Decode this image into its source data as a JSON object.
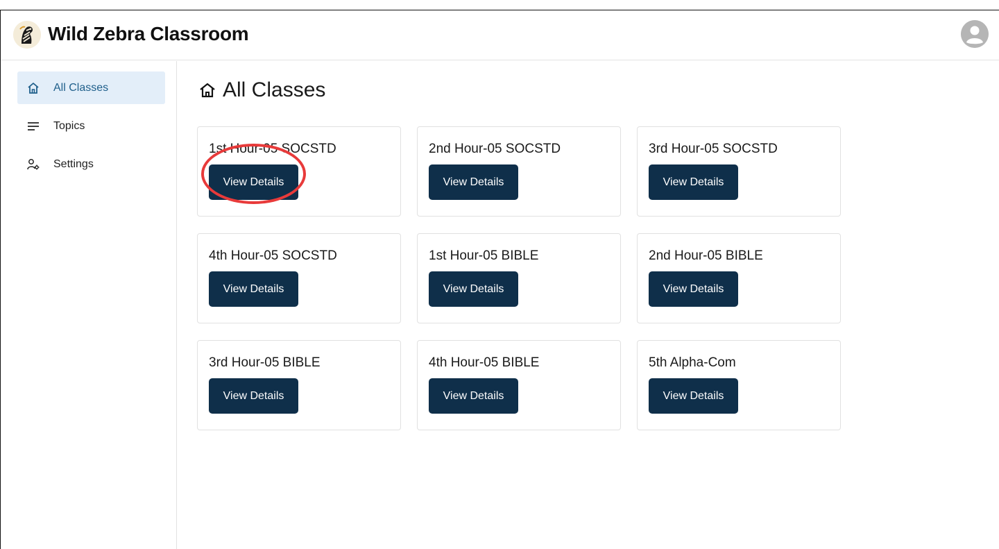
{
  "app": {
    "title": "Wild Zebra Classroom",
    "logo_icon": "zebra-logo-icon",
    "user_icon": "user-avatar-icon"
  },
  "sidebar": {
    "items": [
      {
        "label": "All Classes",
        "icon": "home-icon",
        "active": true
      },
      {
        "label": "Topics",
        "icon": "lines-icon",
        "active": false
      },
      {
        "label": "Settings",
        "icon": "user-gear-icon",
        "active": false
      }
    ]
  },
  "main": {
    "title": "All Classes",
    "title_icon": "home-icon",
    "classes": [
      {
        "name": "1st Hour-05 SOCSTD",
        "button": "View Details"
      },
      {
        "name": "2nd Hour-05 SOCSTD",
        "button": "View Details"
      },
      {
        "name": "3rd Hour-05 SOCSTD",
        "button": "View Details"
      },
      {
        "name": "4th Hour-05 SOCSTD",
        "button": "View Details"
      },
      {
        "name": "1st Hour-05 BIBLE",
        "button": "View Details"
      },
      {
        "name": "2nd Hour-05 BIBLE",
        "button": "View Details"
      },
      {
        "name": "3rd Hour-05 BIBLE",
        "button": "View Details"
      },
      {
        "name": "4th Hour-05 BIBLE",
        "button": "View Details"
      },
      {
        "name": "5th Alpha-Com",
        "button": "View Details"
      }
    ]
  },
  "annotation": {
    "shape": "ellipse",
    "color": "#e83a3a",
    "target": "1st Hour-05 SOCSTD View Details"
  },
  "colors": {
    "button_bg": "#0f2f4a",
    "active_nav_bg": "#e3eef9",
    "active_nav_text": "#1f5f8b"
  }
}
